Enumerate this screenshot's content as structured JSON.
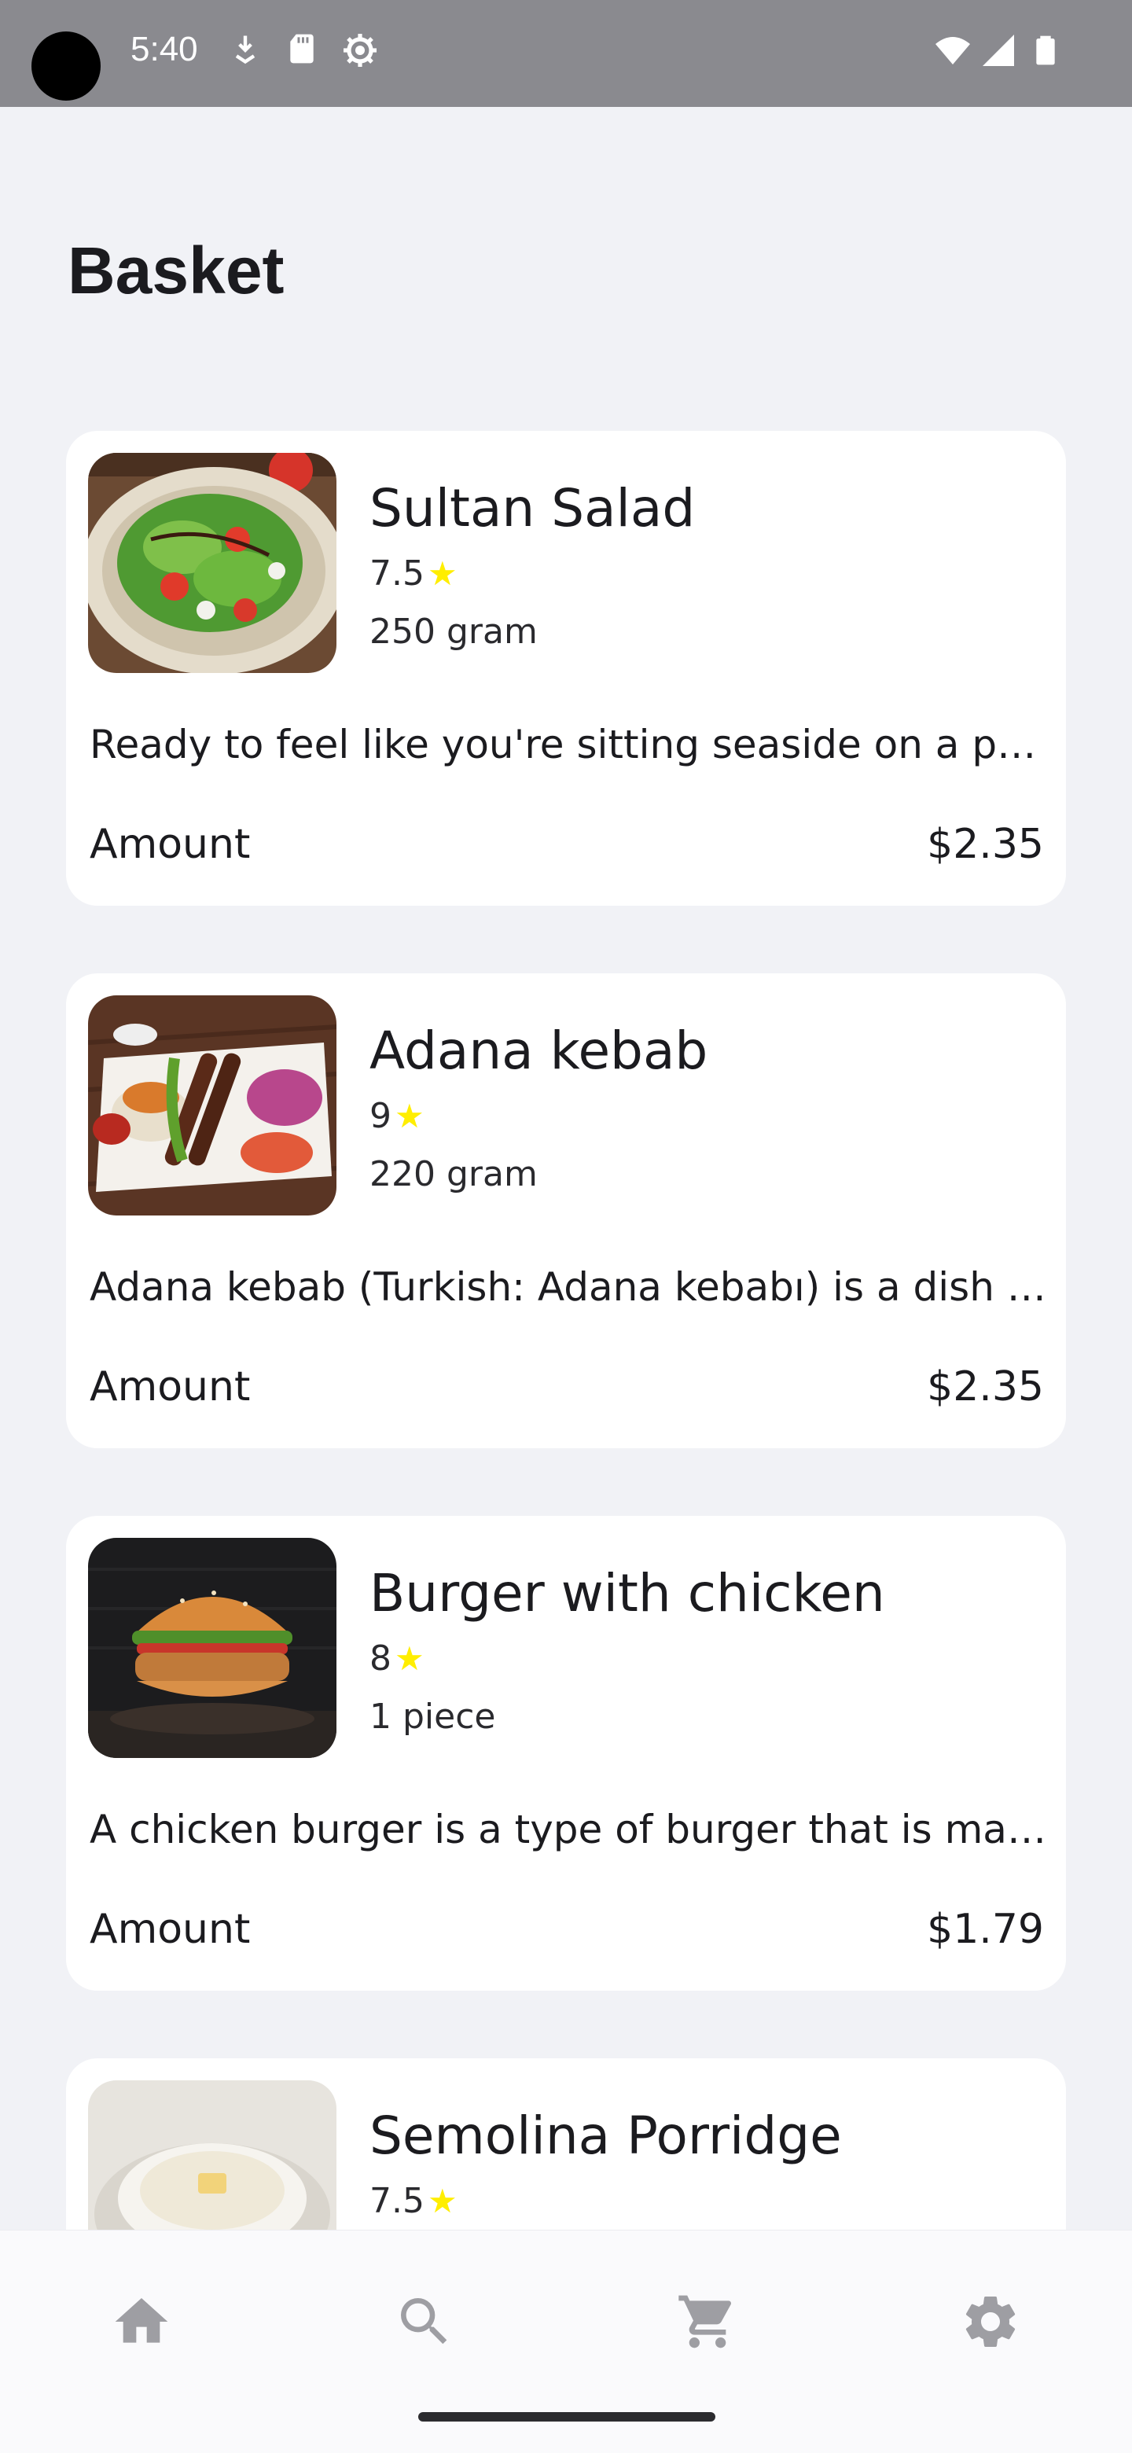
{
  "status_bar": {
    "time": "5:40",
    "left_icons": [
      "download-icon",
      "sd-card-icon",
      "settings-cog-icon"
    ],
    "right_icons": [
      "wifi-icon",
      "signal-icon",
      "battery-icon"
    ]
  },
  "page": {
    "title": "Basket"
  },
  "items": [
    {
      "name": "Sultan Salad",
      "rating": "7.5",
      "weight": "250 gram",
      "description": "Ready to feel like you're sitting seaside on a pe…",
      "amount_label": "Amount",
      "price": "$2.35",
      "image": "salad-photo"
    },
    {
      "name": "Adana kebab",
      "rating": "9",
      "weight": "220 gram",
      "description": "Adana kebab (Turkish: Adana kebabı) is a dish t…",
      "amount_label": "Amount",
      "price": "$2.35",
      "image": "kebab-photo"
    },
    {
      "name": "Burger with chicken",
      "rating": "8",
      "weight": "1 piece",
      "description": "A chicken burger is a type of burger that is mad…",
      "amount_label": "Amount",
      "price": "$1.79",
      "image": "burger-photo"
    },
    {
      "name": "Semolina Porridge",
      "rating": "7.5",
      "image": "porridge-photo"
    }
  ],
  "rating_star": "★",
  "bottom_nav": {
    "items": [
      "home-icon",
      "search-icon",
      "cart-icon",
      "settings-icon"
    ],
    "active_color": "#9e9ea3"
  },
  "colors": {
    "background": "#f1f2f6",
    "card": "#ffffff",
    "star": "#ffee00",
    "status_bar": "#8a8a8f"
  }
}
